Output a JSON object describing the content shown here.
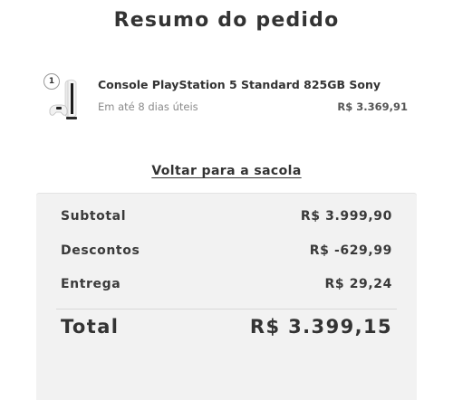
{
  "header": {
    "title": "Resumo do pedido"
  },
  "item": {
    "quantity": "1",
    "image_icon": "ps5-console-image",
    "name": "Console PlayStation 5 Standard 825GB Sony",
    "delivery": "Em até 8 dias úteis",
    "price": "R$ 3.369,91"
  },
  "actions": {
    "back_to_bag": "Voltar para a sacola"
  },
  "summary": {
    "subtotal_label": "Subtotal",
    "subtotal_value": "R$ 3.999,90",
    "discounts_label": "Descontos",
    "discounts_value": "R$ -629,99",
    "shipping_label": "Entrega",
    "shipping_value": "R$ 29,24",
    "total_label": "Total",
    "total_value": "R$ 3.399,15"
  }
}
